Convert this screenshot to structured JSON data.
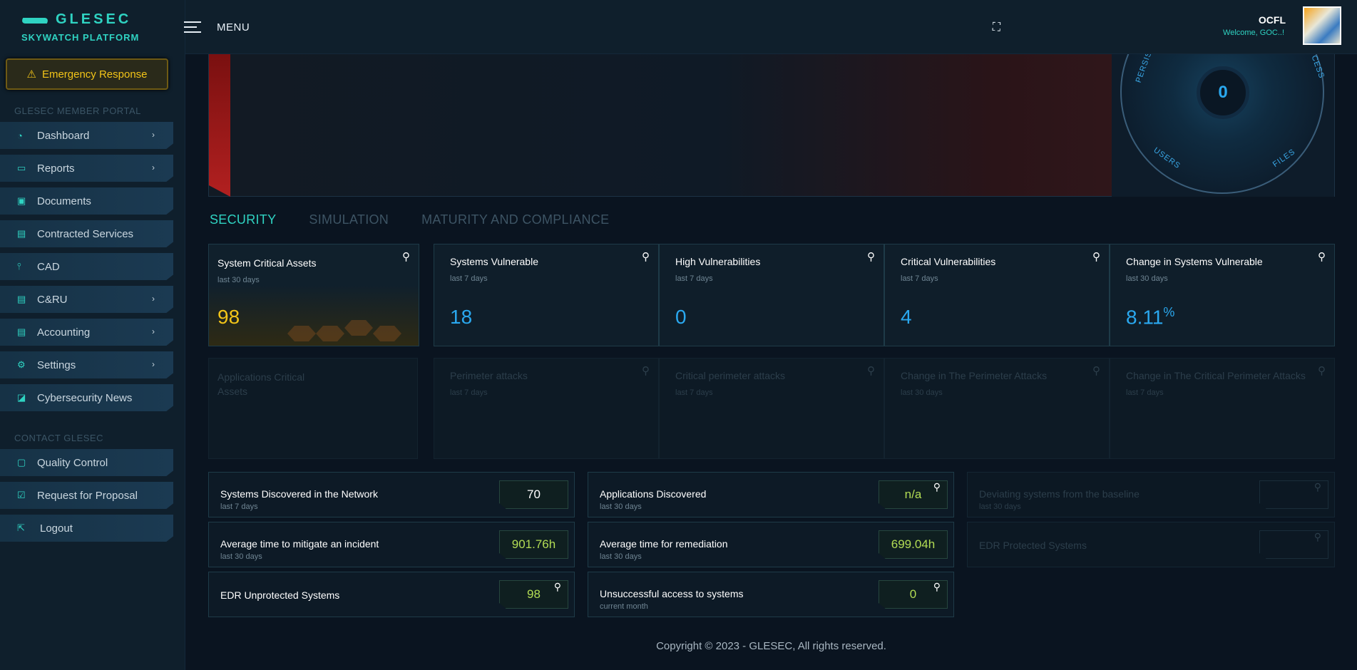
{
  "app": {
    "logo_title": "GLESEC",
    "logo_subtitle": "SKYWATCH PLATFORM",
    "menu_label": "MENU",
    "org_name": "OCFL",
    "welcome": "Welcome, GOC..!"
  },
  "sidebar": {
    "emergency_label": "Emergency Response",
    "section_member": "GLESEC MEMBER PORTAL",
    "items": [
      {
        "label": "Dashboard",
        "icon": "gauge-icon",
        "chevron": true
      },
      {
        "label": "Reports",
        "icon": "monitor-icon",
        "chevron": true
      },
      {
        "label": "Documents",
        "icon": "floppy-icon",
        "chevron": false
      },
      {
        "label": "Contracted Services",
        "icon": "briefcase-icon",
        "chevron": false
      },
      {
        "label": "CAD",
        "icon": "antenna-icon",
        "chevron": false
      },
      {
        "label": "C&RU",
        "icon": "briefcase-icon",
        "chevron": true
      },
      {
        "label": "Accounting",
        "icon": "briefcase-icon",
        "chevron": true
      },
      {
        "label": "Settings",
        "icon": "gear-icon",
        "chevron": true
      },
      {
        "label": "Cybersecurity News",
        "icon": "rss-icon",
        "chevron": false
      }
    ],
    "section_contact": "CONTACT GLESEC",
    "contact_items": [
      {
        "label": "Quality Control",
        "icon": "clipboard-icon"
      },
      {
        "label": "Request for Proposal",
        "icon": "checklist-icon"
      },
      {
        "label": "Logout",
        "icon": "logout-icon"
      }
    ]
  },
  "gauge": {
    "value": "0",
    "labels": [
      "PERSIS",
      "CESS",
      "USERS",
      "FILES"
    ]
  },
  "tabs": [
    "SECURITY",
    "SIMULATION",
    "MATURITY AND COMPLIANCE"
  ],
  "cards_row1": [
    {
      "title": "System Critical Assets",
      "sub": "last 30 days",
      "value": "98"
    },
    {
      "title": "Systems Vulnerable",
      "sub": "last 7 days",
      "value": "18"
    },
    {
      "title": "High Vulnerabilities",
      "sub": "last 7 days",
      "value": "0"
    },
    {
      "title": "Critical Vulnerabilities",
      "sub": "last 7 days",
      "value": "4"
    },
    {
      "title": "Change in Systems Vulnerable",
      "sub": "last 30 days",
      "value": "8.11",
      "unit": "%"
    }
  ],
  "cards_row2": [
    {
      "title": "Applications Critical Assets"
    },
    {
      "title": "Perimeter attacks",
      "sub": "last 7 days"
    },
    {
      "title": "Critical perimeter attacks",
      "sub": "last 7 days"
    },
    {
      "title": "Change in The Perimeter Attacks",
      "sub": "last 30 days"
    },
    {
      "title": "Change in The Critical Perimeter Attacks",
      "sub": "last 7 days"
    }
  ],
  "stats": {
    "systems_discovered": {
      "title": "Systems Discovered in the Network",
      "sub": "last 7 days",
      "value": "70"
    },
    "apps_discovered": {
      "title": "Applications Discovered",
      "sub": "last 30 days",
      "value": "n/a"
    },
    "deviating": {
      "title": "Deviating systems from the baseline",
      "sub": "last 30 days"
    },
    "avg_mitigate": {
      "title": "Average time to mitigate an incident",
      "sub": "last 30 days",
      "value": "901.76h"
    },
    "avg_remediation": {
      "title": "Average time for remediation",
      "sub": "last 30 days",
      "value": "699.04h"
    },
    "edr_protected": {
      "title": "EDR Protected Systems"
    },
    "edr_unprotected": {
      "title": "EDR Unprotected Systems",
      "value": "98"
    },
    "unsuccessful_access": {
      "title": "Unsuccessful access to systems",
      "sub": "current month",
      "value": "0"
    }
  },
  "footer": "Copyright © 2023 - GLESEC, All rights reserved."
}
